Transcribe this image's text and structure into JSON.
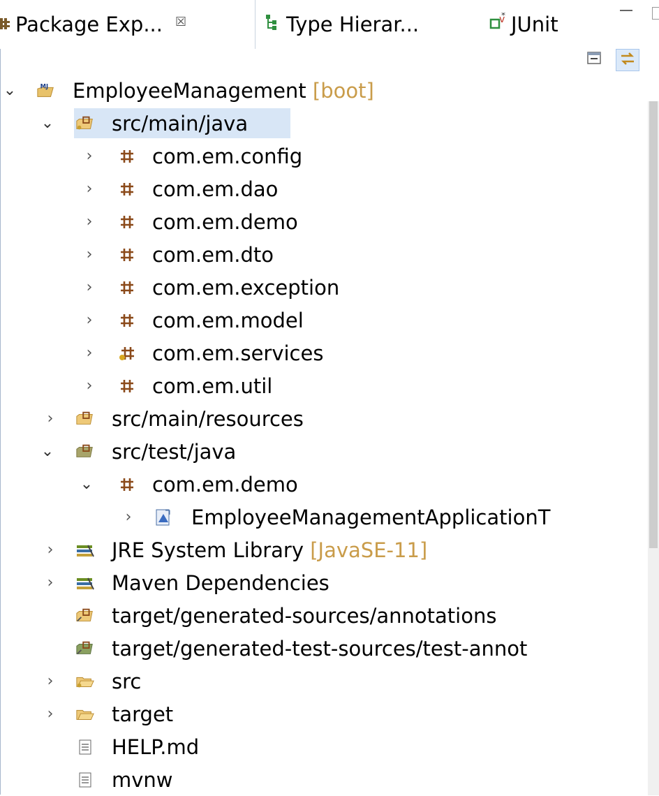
{
  "tabs": [
    {
      "label": "Package Exp...",
      "icon": "package-explorer-icon",
      "active": true,
      "close": "☒"
    },
    {
      "label": "Type Hierar...",
      "icon": "type-hierarchy-icon",
      "active": false
    },
    {
      "label": "JUnit",
      "icon": "junit-icon",
      "active": false
    }
  ],
  "toolbar": {
    "collapse_all": "collapse-all-icon",
    "link_editor": "link-with-editor-icon"
  },
  "tree": {
    "project": {
      "name": "EmployeeManagement",
      "decoration": "[boot]"
    },
    "src_main_java": "src/main/java",
    "packages": [
      "com.em.config",
      "com.em.dao",
      "com.em.demo",
      "com.em.dto",
      "com.em.exception",
      "com.em.model",
      "com.em.services",
      "com.em.util"
    ],
    "src_main_resources": "src/main/resources",
    "src_test_java": "src/test/java",
    "test_package": "com.em.demo",
    "test_class": "EmployeeManagementApplicationT",
    "jre": {
      "name": "JRE System Library",
      "decoration": "[JavaSE-11]"
    },
    "maven": "Maven Dependencies",
    "gen_sources": "target/generated-sources/annotations",
    "gen_test_sources": "target/generated-test-sources/test-annot",
    "src": "src",
    "target": "target",
    "help": "HELP.md",
    "mvnw": "mvnw"
  },
  "colors": {
    "selection": "#d8e6f6",
    "decoration": "#c99c4a",
    "package": "#8b5a2b"
  }
}
